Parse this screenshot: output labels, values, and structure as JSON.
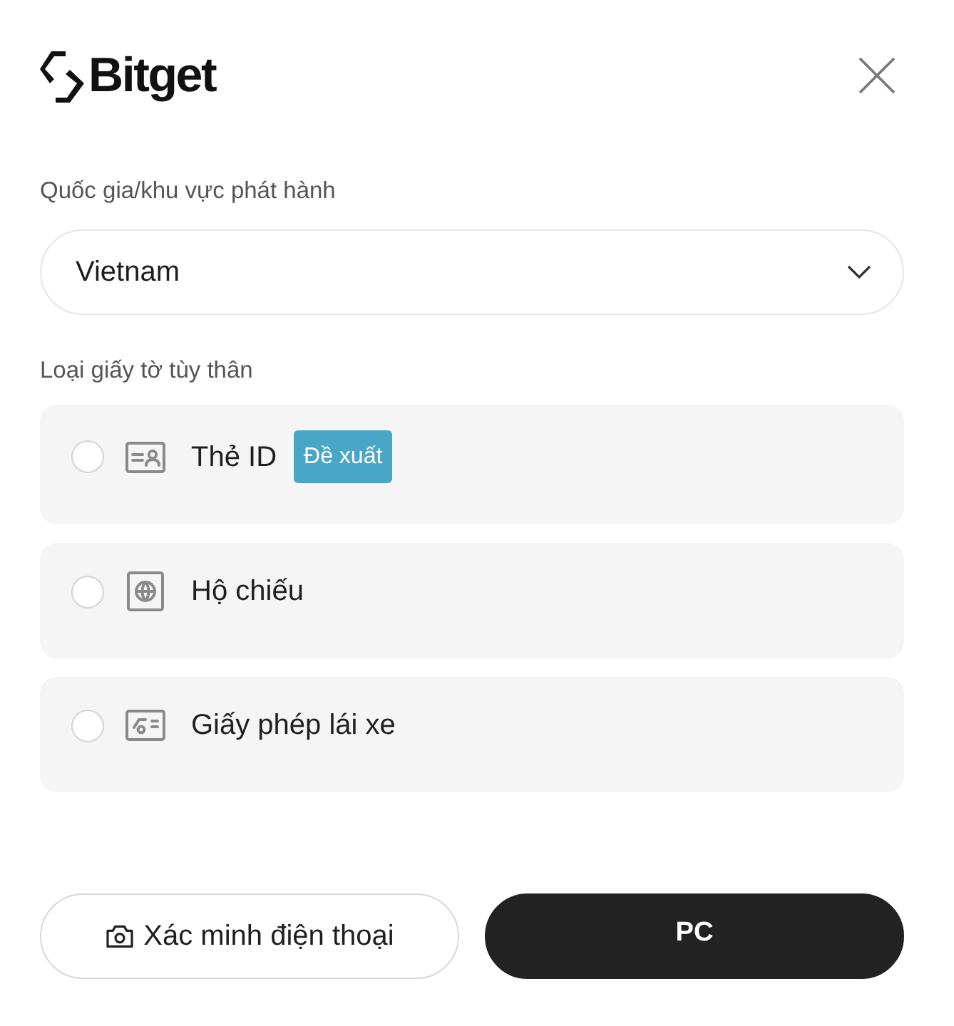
{
  "logo": {
    "text": "Bitget"
  },
  "country": {
    "label": "Quốc gia/khu vực phát hành",
    "value": "Vietnam"
  },
  "document_type": {
    "label": "Loại giấy tờ tùy thân",
    "options": [
      {
        "kind": "id-card",
        "label": "Thẻ ID",
        "badge": "Đề xuất",
        "selected": false
      },
      {
        "kind": "passport",
        "label": "Hộ chiếu",
        "selected": false
      },
      {
        "kind": "license",
        "label": "Giấy phép lái xe",
        "selected": false
      }
    ]
  },
  "buttons": [
    {
      "kind": "outline",
      "label": "Xác minh điện thoại"
    },
    {
      "kind": "filled",
      "label": "PC"
    }
  ]
}
